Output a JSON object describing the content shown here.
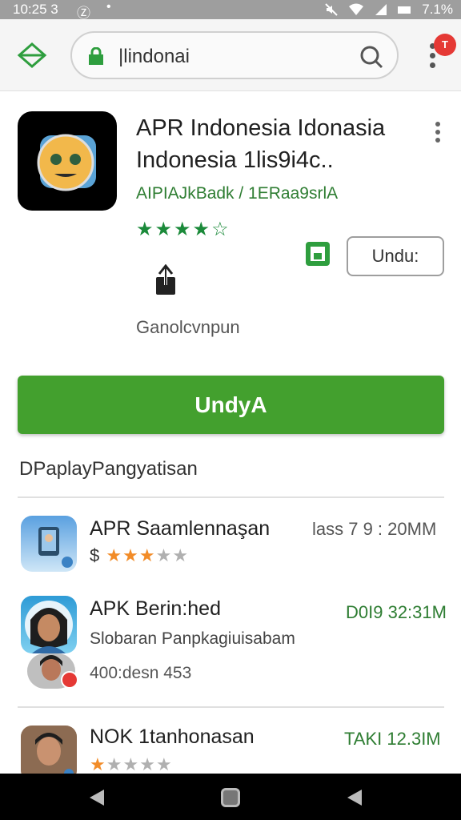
{
  "status_bar": {
    "time": "10:25 3",
    "notification_glyph": "Ⓩ",
    "dot": "•",
    "right_text": "7.1%",
    "icons": [
      "mute-icon",
      "wifi-icon",
      "signal-icon",
      "battery-icon"
    ]
  },
  "browser": {
    "url_text": "|lindonai",
    "menu_badge": "T",
    "icons": [
      "back-arrow-icon",
      "lock-icon",
      "search-icon",
      "more-vert-icon"
    ]
  },
  "app": {
    "title": "APR Indonesia  Idonasia Indonesia 1lis9i4c..",
    "developer": "AIPIAJkBadk  / 1ERaa9srlA",
    "rating_stars": 4,
    "rating_max": 5,
    "install_small_label": "Undu:",
    "share_label": "Ganolcvnpun",
    "install_label": "UndyA",
    "accent_color": "#43a02e"
  },
  "section": {
    "title": "DPaplayPangyatisan"
  },
  "list": [
    {
      "title": "APR Saamlennaşan",
      "meta": "lass 7 9 : 20MM",
      "prefix": "$",
      "stars": 3,
      "stars_max": 5
    },
    {
      "title": "APK Berin:hed",
      "meta": "D0I9 32:31M",
      "subtitle": "Slobaran Panpkagiuisabam",
      "size": "400:desn 453"
    },
    {
      "title": "NOK 1tanhonasan",
      "meta": "TAKI 12.3IM",
      "stars": 1,
      "stars_max": 5
    }
  ]
}
